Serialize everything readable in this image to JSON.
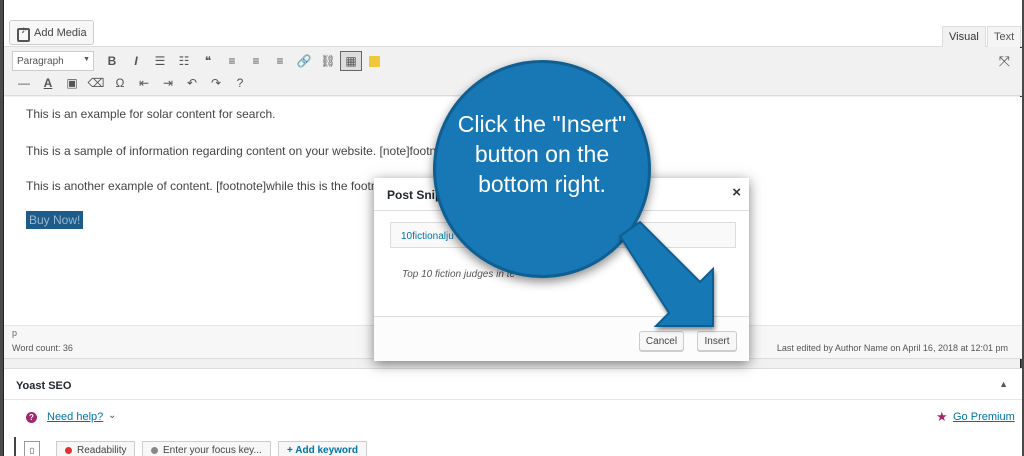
{
  "topbar": {
    "add_media_label": "Add Media",
    "tab_visual": "Visual",
    "tab_text": "Text"
  },
  "toolbar": {
    "format_select": "Paragraph",
    "row1_icons": [
      "bold-icon",
      "italic-icon",
      "bulleted-list-icon",
      "numbered-list-icon",
      "blockquote-icon",
      "align-left-icon",
      "align-center-icon",
      "align-right-icon",
      "link-icon",
      "unlink-icon",
      "toolbar-toggle-icon",
      "snippet-icon"
    ],
    "row1_glyphs": [
      "B",
      "I",
      "☰",
      "☷",
      "❝",
      "≡",
      "≡",
      "≡",
      "🔗",
      "⛓",
      "▦",
      ""
    ],
    "row2_icons": [
      "strikethrough-icon",
      "text-color-icon",
      "paste-text-icon",
      "clear-formatting-icon",
      "special-character-icon",
      "outdent-icon",
      "indent-icon",
      "undo-icon",
      "redo-icon",
      "help-icon"
    ],
    "row2_glyphs": [
      "—",
      "A",
      "▣",
      "⌫",
      "Ω",
      "⇤",
      "⇥",
      "↶",
      "↷",
      "?"
    ]
  },
  "editor": {
    "line1": "This is an example for solar content for search.",
    "line2": "This is a sample of information regarding content on your website. [note]footnote",
    "line3": "This is another example of content. [footnote]while this is the footno",
    "buy_now": "Buy Now!",
    "path": "p",
    "word_count": "Word count: 36",
    "last_edited": "Last edited by Author Name on April 16, 2018 at 12:01 pm"
  },
  "yoast": {
    "title": "Yoast SEO",
    "help_link": "Need help?",
    "go_premium": "Go Premium",
    "tab_readability": "Readability",
    "tab_focus": "Enter your focus key...",
    "tab_add_keyword": "+ Add keyword",
    "colors": {
      "brand": "#a4286a",
      "readability_dot": "#dc3232",
      "focus_dot": "#888888"
    }
  },
  "modal": {
    "title": "Post Snip",
    "close": "×",
    "snippet_name": "10fictionalju",
    "snippet_description": "Top 10 fiction judges in te",
    "cancel_label": "Cancel",
    "insert_label": "Insert"
  },
  "callout": {
    "text": "Click the \"Insert\" button on the bottom right.",
    "color": "#1778b5"
  }
}
